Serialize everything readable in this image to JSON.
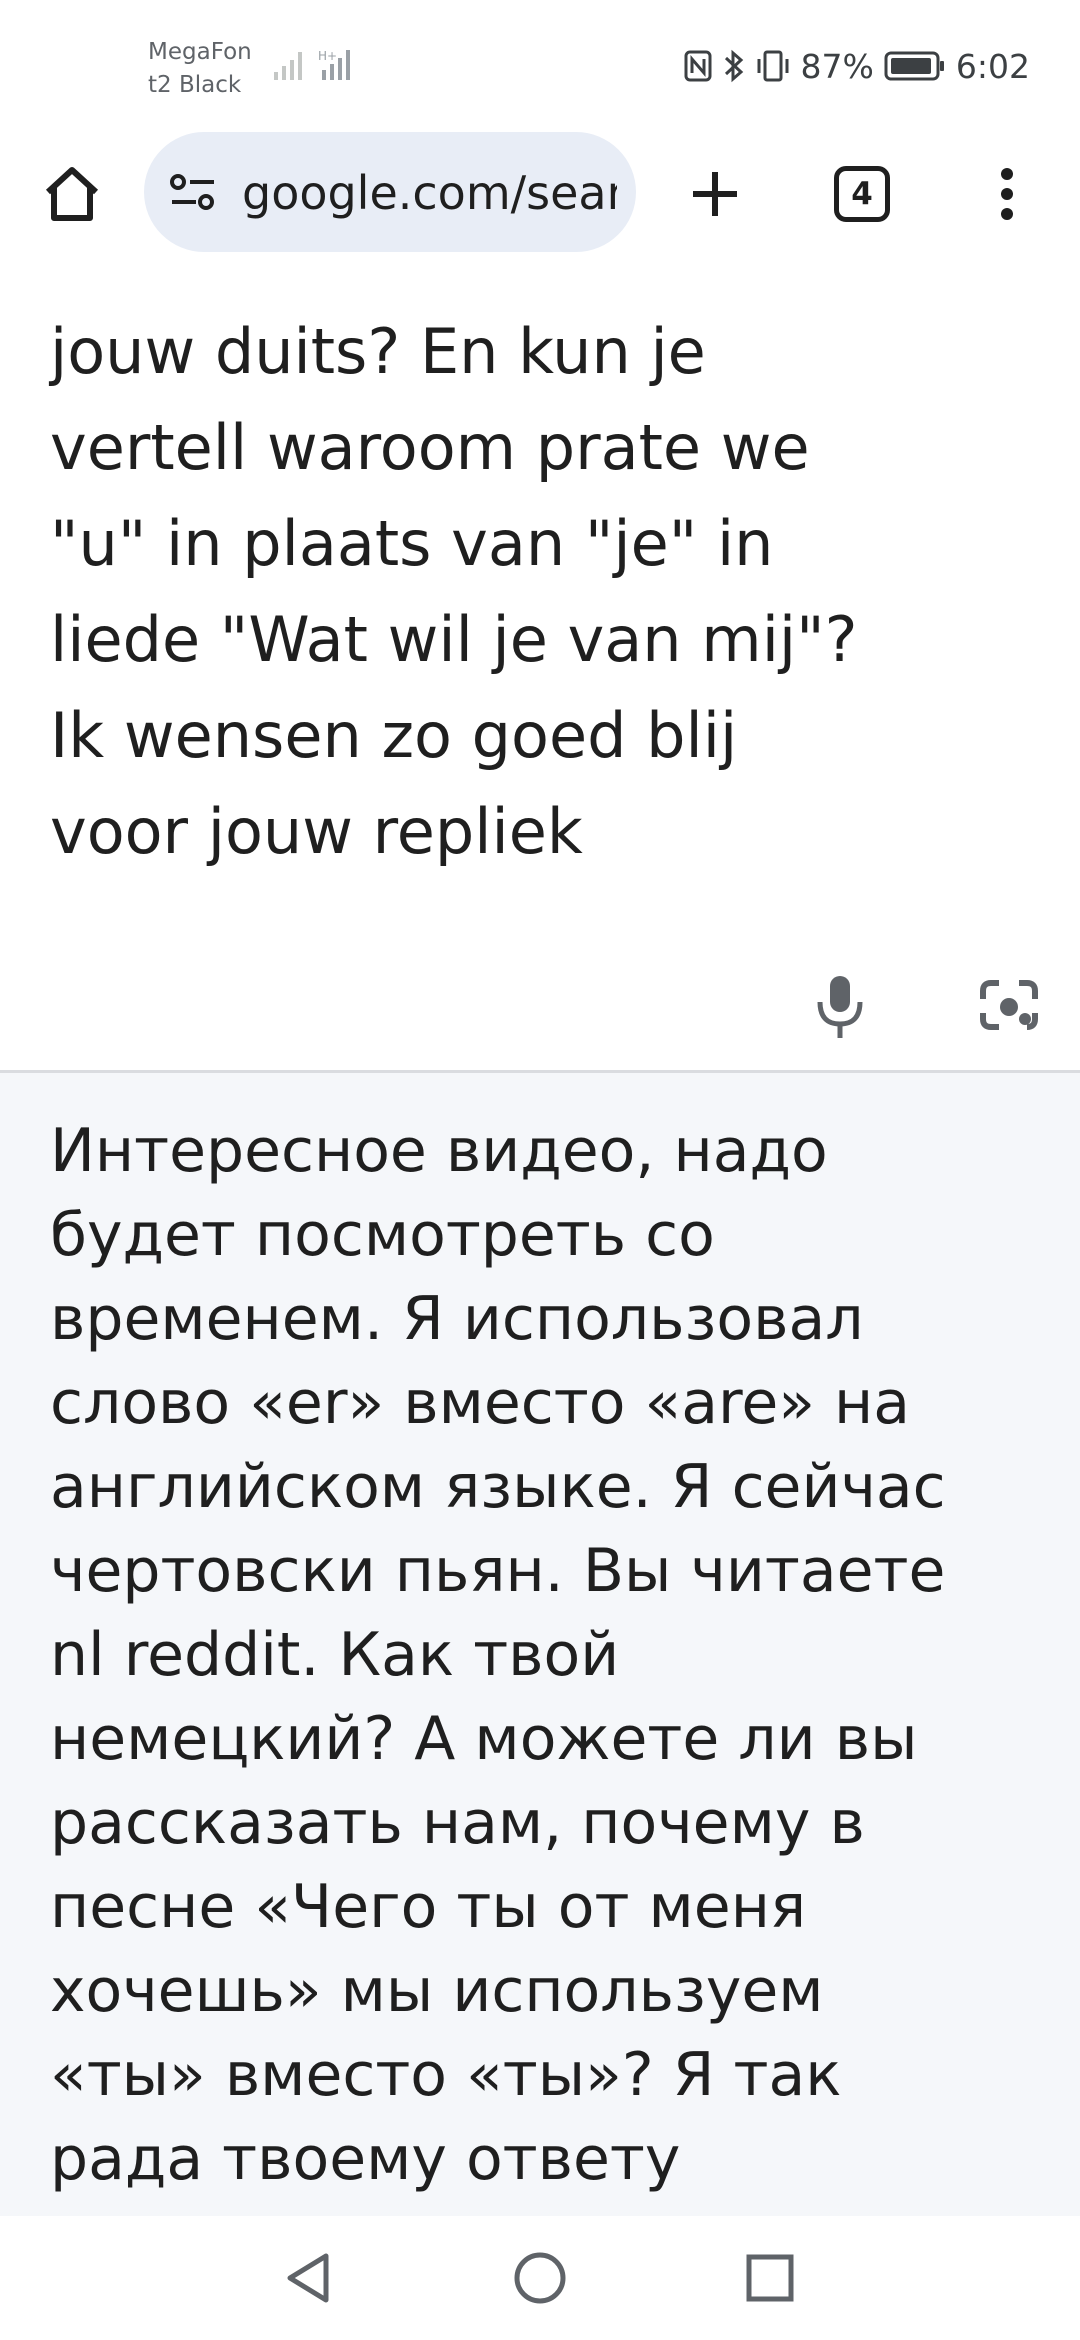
{
  "status_bar": {
    "carrier_line1": "MegaFon",
    "carrier_line2": "t2 Black",
    "battery_percent": "87%",
    "time": "6:02"
  },
  "toolbar": {
    "url": "google.com/search",
    "tab_count": "4"
  },
  "source": {
    "lines": "lezen nl reddit. Hoe is\njouw duits? En kun je\nvertell waroom prate we\n\"u\" in plaats van \"je\" in\nliede \"Wat wil je van mij\"?\nIk wensen zo goed blij\nvoor jouw repliek"
  },
  "translation": {
    "lines": "Интересное видео, надо\nбудет посмотреть со\nвременем. Я использовал\nслово «er» вместо «are» на\nанглийском языке. Я сейчас\nчертовски пьян. Вы читаете\nnl reddit. Как твой\nнемецкий? А можете ли вы\nрассказать нам, почему в\nпесне «Чего ты от меня\nхочешь» мы используем\n«ты» вместо «ты»? Я так\nрада твоему ответу"
  },
  "icons": {
    "home": "home-icon",
    "site_info": "tune-icon",
    "new_tab": "plus-icon",
    "tabs": "tab-switcher-icon",
    "menu": "more-vert-icon",
    "mic": "mic-icon",
    "lens": "camera-lens-icon",
    "nav_back": "triangle-back-icon",
    "nav_home": "circle-home-icon",
    "nav_recents": "square-recents-icon"
  },
  "colors": {
    "url_box": "#e8edf6",
    "translation_bg": "#f5f7fa",
    "text": "#1f1f1f"
  }
}
